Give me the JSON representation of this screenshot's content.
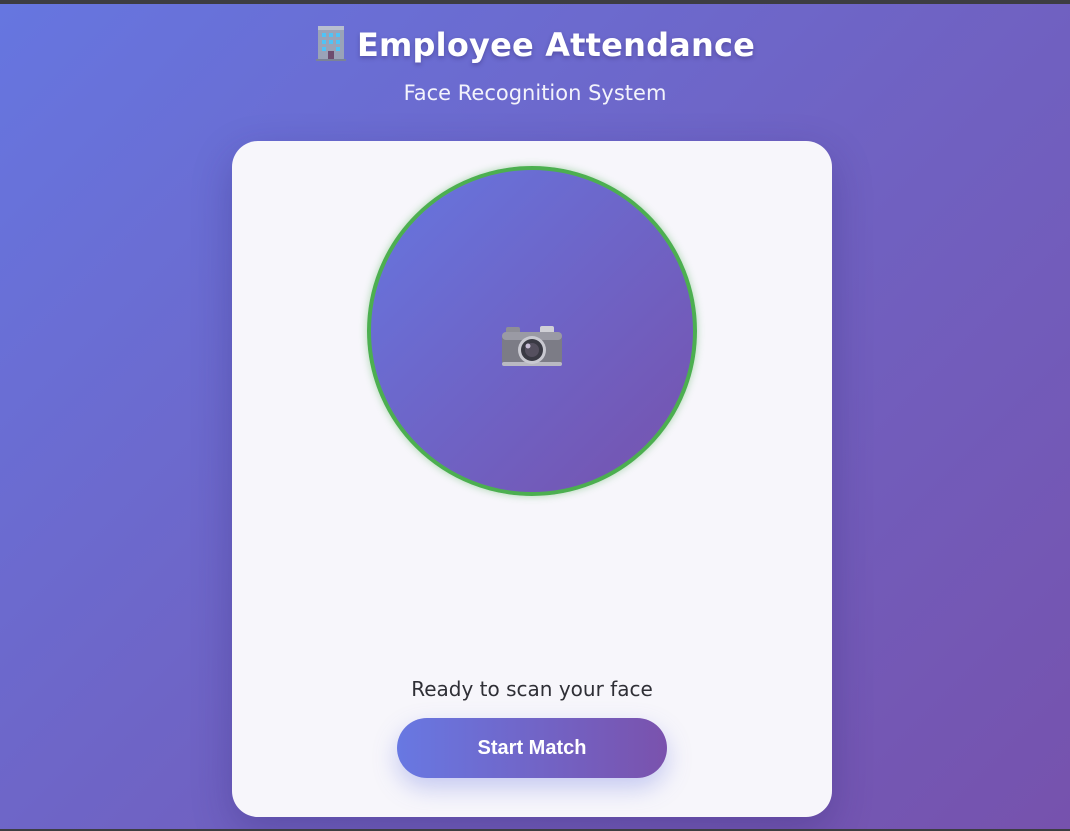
{
  "header": {
    "title": "Employee Attendance",
    "title_icon": "office-building-icon",
    "subtitle": "Face Recognition System"
  },
  "scanner": {
    "icon": "camera-icon",
    "ring_color": "#4caf50",
    "status_text": "Ready to scan your face"
  },
  "actions": {
    "start_label": "Start Match"
  },
  "colors": {
    "gradient_start": "#6676e0",
    "gradient_end": "#7652ad",
    "card_background": "#f7f6fb",
    "ring": "#4caf50"
  }
}
